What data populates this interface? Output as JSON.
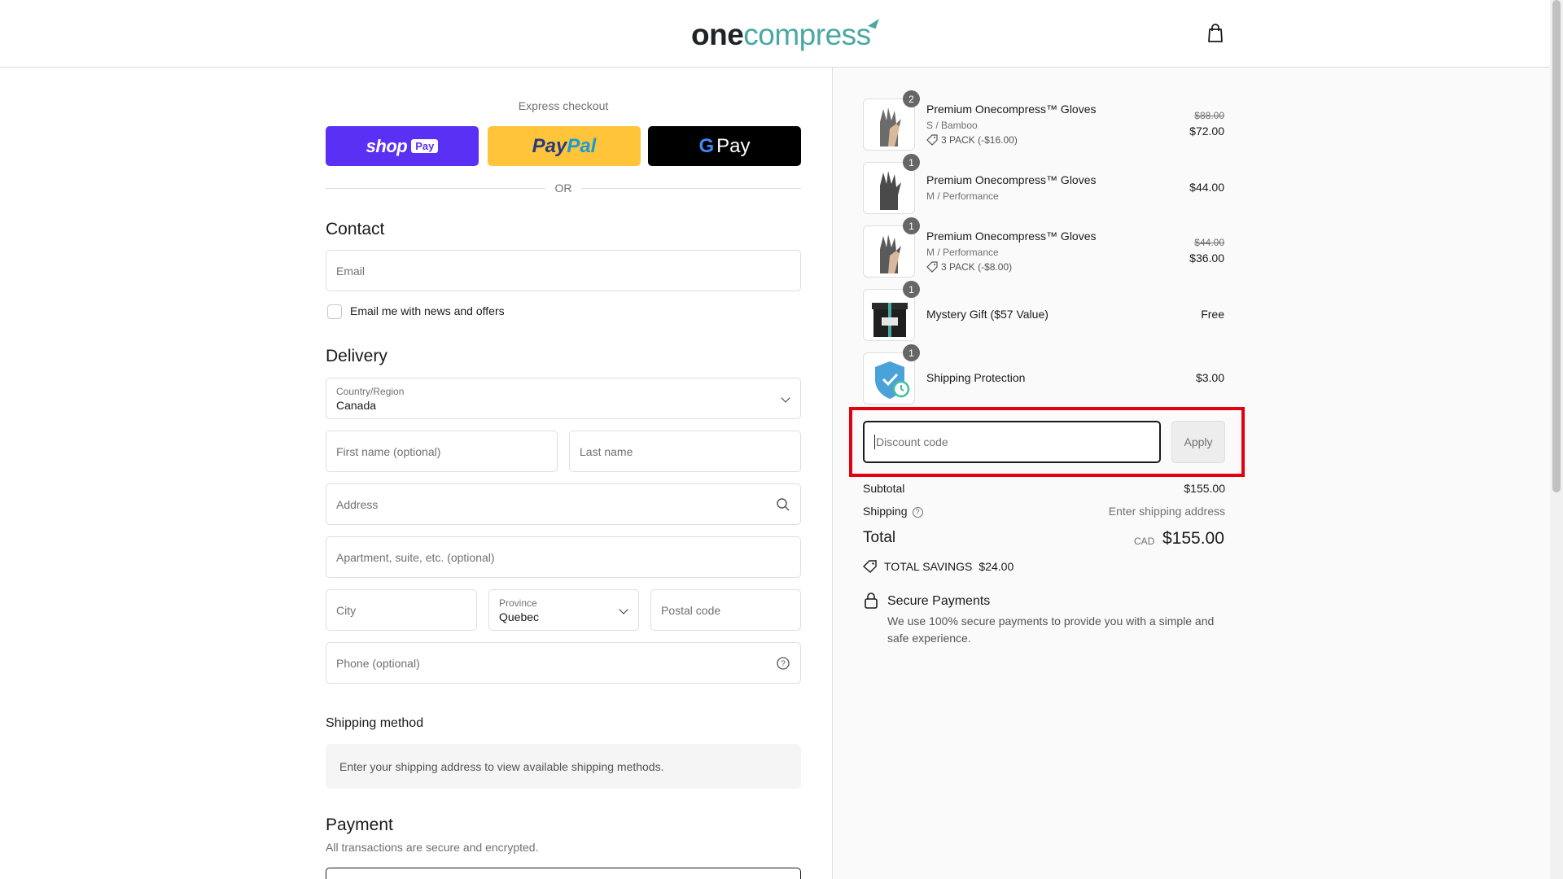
{
  "header": {
    "logo_one": "one",
    "logo_compress": "compress"
  },
  "express": {
    "title": "Express checkout",
    "shop": "shop",
    "shop_pay": "Pay",
    "paypal_1": "Pay",
    "paypal_2": "Pal",
    "gpay_g": "G",
    "gpay_pay": "Pay",
    "or": "OR"
  },
  "contact": {
    "title": "Contact",
    "email_placeholder": "Email",
    "newsletter_label": "Email me with news and offers"
  },
  "delivery": {
    "title": "Delivery",
    "country_label": "Country/Region",
    "country_value": "Canada",
    "first_name_placeholder": "First name (optional)",
    "last_name_placeholder": "Last name",
    "address_placeholder": "Address",
    "apartment_placeholder": "Apartment, suite, etc. (optional)",
    "city_placeholder": "City",
    "province_label": "Province",
    "province_value": "Quebec",
    "postal_placeholder": "Postal code",
    "phone_placeholder": "Phone (optional)"
  },
  "shipping_method": {
    "title": "Shipping method",
    "info": "Enter your shipping address to view available shipping methods."
  },
  "payment": {
    "title": "Payment",
    "subtitle": "All transactions are secure and encrypted."
  },
  "cart": {
    "items": [
      {
        "qty": "2",
        "name": "Premium Onecompress™ Gloves",
        "variant": "S / Bamboo",
        "discount": "3 PACK (-$16.00)",
        "original": "$88.00",
        "price": "$72.00"
      },
      {
        "qty": "1",
        "name": "Premium Onecompress™ Gloves",
        "variant": "M / Performance",
        "price": "$44.00"
      },
      {
        "qty": "1",
        "name": "Premium Onecompress™ Gloves",
        "variant": "M / Performance",
        "discount": "3 PACK (-$8.00)",
        "original": "$44.00",
        "price": "$36.00"
      },
      {
        "qty": "1",
        "name": "Mystery Gift ($57 Value)",
        "price": "Free"
      },
      {
        "qty": "1",
        "name": "Shipping Protection",
        "price": "$3.00"
      }
    ],
    "discount_placeholder": "Discount code",
    "apply_label": "Apply",
    "subtotal_label": "Subtotal",
    "subtotal_value": "$155.00",
    "shipping_label": "Shipping",
    "shipping_value": "Enter shipping address",
    "total_label": "Total",
    "total_currency": "CAD",
    "total_value": "$155.00",
    "savings_label": "TOTAL SAVINGS",
    "savings_value": "$24.00",
    "secure_title": "Secure Payments",
    "secure_text": "We use 100% secure payments to provide you with a simple and safe experience."
  },
  "colors": {
    "accent": "#4aa8a4",
    "shop_pay": "#5a31f4",
    "paypal": "#ffc439",
    "highlight": "#e3000f"
  }
}
